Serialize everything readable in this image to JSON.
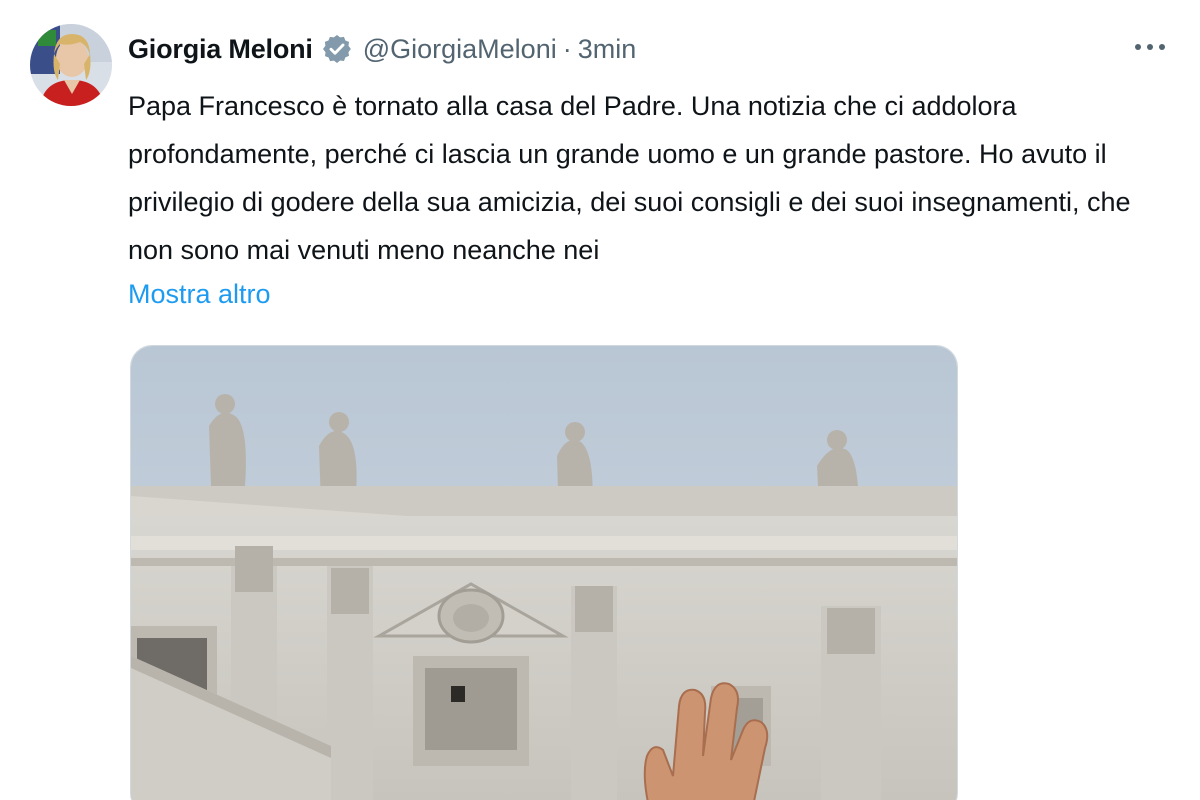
{
  "tweet": {
    "author_name": "Giorgia Meloni",
    "handle": "@GiorgiaMeloni",
    "separator": "·",
    "time": "3min",
    "text": "Papa Francesco è tornato alla casa del Padre. Una notizia che ci addolora profondamente, perché ci lascia un grande uomo e un grande pastore. Ho avuto il privilegio di godere della sua amicizia, dei suoi consigli e dei suoi insegnamenti, che non sono mai venuti meno neanche nei",
    "show_more": "Mostra altro"
  },
  "colors": {
    "link": "#1d9bf0",
    "verified_badge": "#829aab",
    "secondary_text": "#536471"
  },
  "icons": {
    "verified": "verified-badge-icon",
    "more": "more-horizontal-icon"
  }
}
